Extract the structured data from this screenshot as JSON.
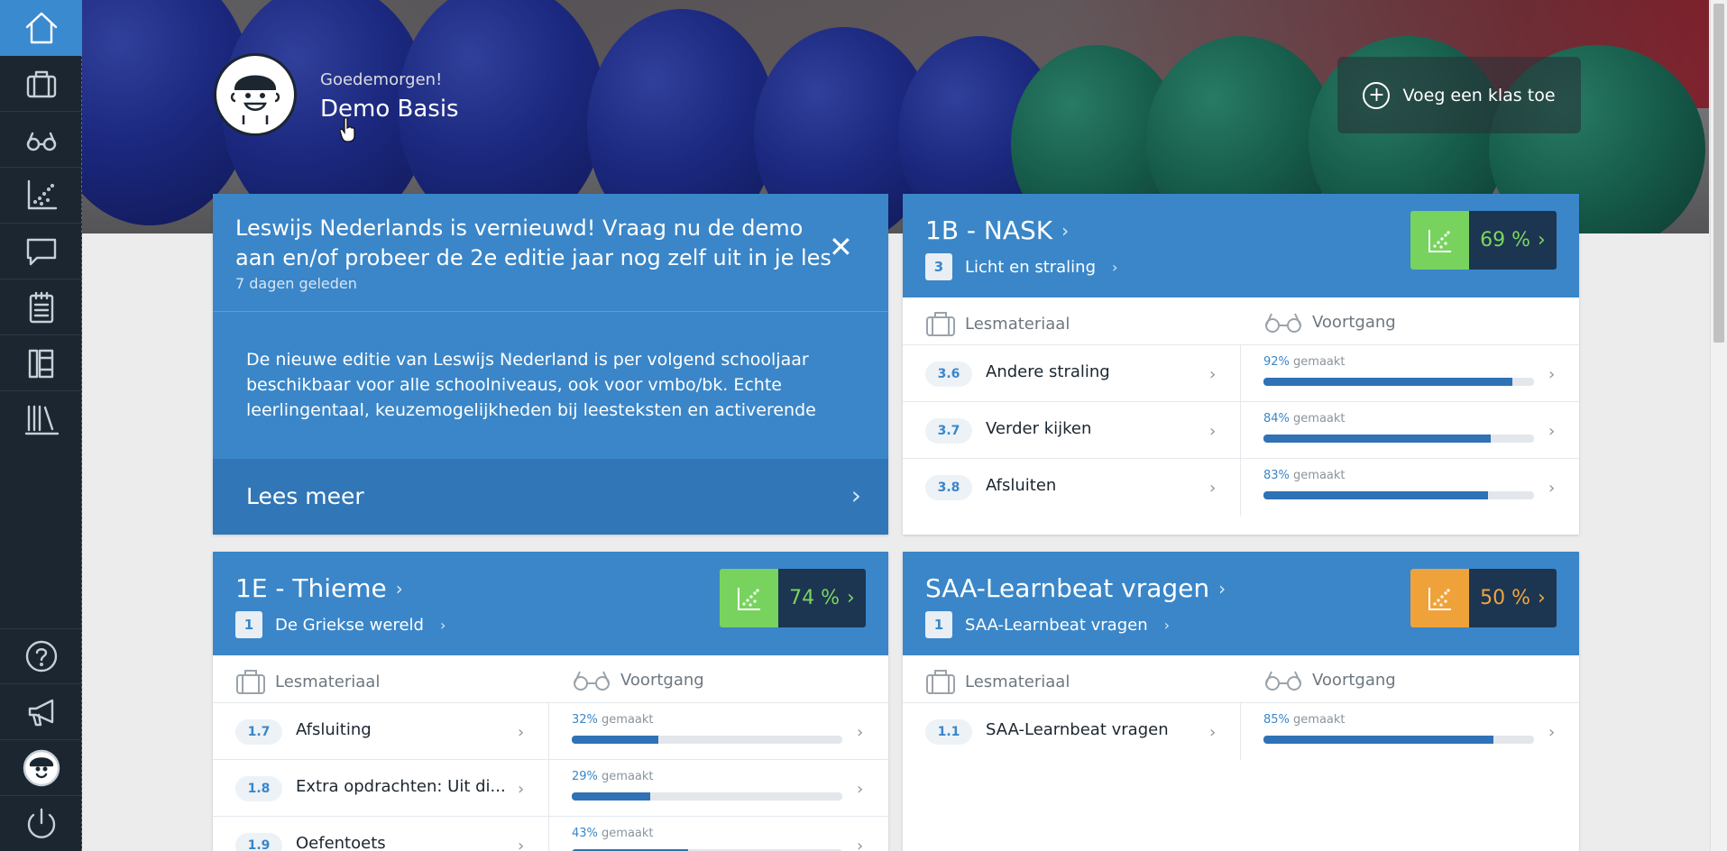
{
  "sidebar": {
    "items": [
      {
        "name": "home",
        "icon": "home-icon"
      },
      {
        "name": "lesmateriaal",
        "icon": "briefcase-icon"
      },
      {
        "name": "voortgang",
        "icon": "glasses-icon"
      },
      {
        "name": "resultaten",
        "icon": "chart-icon"
      },
      {
        "name": "berichten",
        "icon": "chat-icon"
      },
      {
        "name": "toetsen",
        "icon": "clipboard-icon"
      },
      {
        "name": "methodes",
        "icon": "books-icon"
      },
      {
        "name": "bibliotheek",
        "icon": "library-icon"
      }
    ],
    "bottom_items": [
      {
        "name": "help",
        "icon": "help-icon"
      },
      {
        "name": "nieuws",
        "icon": "megaphone-icon"
      },
      {
        "name": "profiel",
        "icon": "avatar-icon"
      },
      {
        "name": "uitloggen",
        "icon": "power-icon"
      }
    ]
  },
  "header": {
    "greeting": "Goedemorgen!",
    "user_name": "Demo Basis",
    "add_class_label": "Voeg een klas toe"
  },
  "news": {
    "title": "Leswijs Nederlands is vernieuwd! Vraag nu de demo aan en/of probeer de 2e editie jaar nog zelf uit in je les",
    "date": "7 dagen geleden",
    "body": "De nieuwe editie van Leswijs Nederland is per volgend schooljaar beschikbaar voor alle schoolniveaus, ook voor vmbo/bk.  Echte leerlingentaal, keuzemogelijkheden bij leesteksten en activerende",
    "read_more": "Lees meer",
    "close": "✕"
  },
  "labels": {
    "lesmateriaal": "Lesmateriaal",
    "voortgang": "Voortgang",
    "gemaakt": "gemaakt"
  },
  "classes": [
    {
      "title": "1B - NASK",
      "chapter_num": "3",
      "chapter_name": "Licht en straling",
      "score": "69 %",
      "score_color": "#78d35e",
      "rows": [
        {
          "num": "3.6",
          "name": "Andere straling",
          "progress_text": "92%",
          "progress": 0.92
        },
        {
          "num": "3.7",
          "name": "Verder kijken",
          "progress_text": "84%",
          "progress": 0.84
        },
        {
          "num": "3.8",
          "name": "Afsluiten",
          "progress_text": "83%",
          "progress": 0.83
        }
      ]
    },
    {
      "title": "1E - Thieme",
      "chapter_num": "1",
      "chapter_name": "De Griekse wereld",
      "score": "74 %",
      "score_color": "#78d35e",
      "rows": [
        {
          "num": "1.7",
          "name": "Afsluiting",
          "progress_text": "32%",
          "progress": 0.32
        },
        {
          "num": "1.8",
          "name": "Extra opdrachten: Uit di...",
          "progress_text": "29%",
          "progress": 0.29
        },
        {
          "num": "1.9",
          "name": "Oefentoets",
          "progress_text": "43%",
          "progress": 0.43
        }
      ]
    },
    {
      "title": "SAA-Learnbeat vragen",
      "chapter_num": "1",
      "chapter_name": "SAA-Learnbeat vragen",
      "score": "50 %",
      "score_color": "#f0a23a",
      "rows": [
        {
          "num": "1.1",
          "name": "SAA-Learnbeat vragen",
          "progress_text": "85%",
          "progress": 0.85
        }
      ]
    }
  ]
}
